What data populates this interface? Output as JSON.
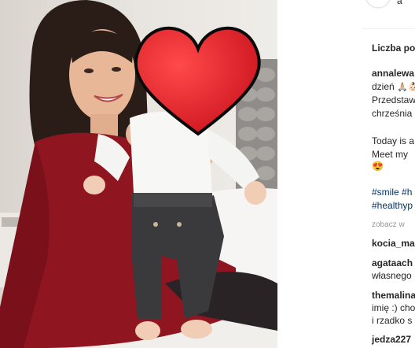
{
  "header": {
    "avatar_label": "annalewandowska",
    "username_fragment": "a"
  },
  "likes": {
    "label": "Liczba po"
  },
  "caption": {
    "username": "annalewa",
    "line1": "dzień",
    "line1_emojis": "🙏🏼👶🏻",
    "line2": "Przedstaw",
    "line3": "chrześnia",
    "line4": "Today is a",
    "line5": "Meet my",
    "line6_emoji": "😍"
  },
  "hashtags": {
    "line1_a": "#smile",
    "line1_b": "#h",
    "line2": "#healthyp"
  },
  "view_all": {
    "label": "zobacz w"
  },
  "comments": [
    {
      "user": "kocia_ma",
      "text": ""
    },
    {
      "user": "agataach",
      "text": "własnego"
    },
    {
      "user": "themalina",
      "text": "imię :) cho",
      "text2": "i rzadko s"
    },
    {
      "user": "jedza227",
      "text": ""
    }
  ],
  "colors": {
    "heart": "#e8262c",
    "dress": "#8f1620",
    "link": "#003569"
  }
}
